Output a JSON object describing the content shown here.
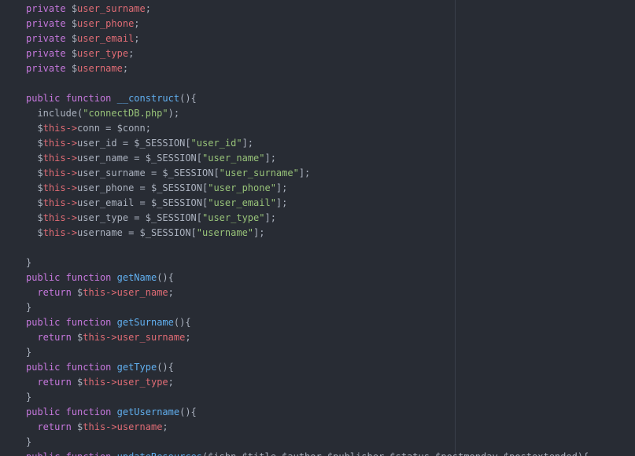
{
  "editor": {
    "colors": {
      "background": "#282c34",
      "wrap_guide": "#3a3f4a"
    },
    "token_colors": {
      "kw": "#c678dd",
      "var": "#e06c75",
      "fn": "#61afef",
      "str": "#98c379",
      "plain": "#abb2bf"
    },
    "lines": [
      [
        [
          "kw",
          "private"
        ],
        [
          "plain",
          " "
        ],
        [
          "plain",
          "$"
        ],
        [
          "var",
          "user_surname"
        ],
        [
          "plain",
          ";"
        ]
      ],
      [
        [
          "kw",
          "private"
        ],
        [
          "plain",
          " "
        ],
        [
          "plain",
          "$"
        ],
        [
          "var",
          "user_phone"
        ],
        [
          "plain",
          ";"
        ]
      ],
      [
        [
          "kw",
          "private"
        ],
        [
          "plain",
          " "
        ],
        [
          "plain",
          "$"
        ],
        [
          "var",
          "user_email"
        ],
        [
          "plain",
          ";"
        ]
      ],
      [
        [
          "kw",
          "private"
        ],
        [
          "plain",
          " "
        ],
        [
          "plain",
          "$"
        ],
        [
          "var",
          "user_type"
        ],
        [
          "plain",
          ";"
        ]
      ],
      [
        [
          "kw",
          "private"
        ],
        [
          "plain",
          " "
        ],
        [
          "plain",
          "$"
        ],
        [
          "var",
          "username"
        ],
        [
          "plain",
          ";"
        ]
      ],
      [],
      [
        [
          "kw",
          "public"
        ],
        [
          "plain",
          " "
        ],
        [
          "kw",
          "function"
        ],
        [
          "plain",
          " "
        ],
        [
          "fn",
          "__construct"
        ],
        [
          "plain",
          "(){"
        ]
      ],
      [
        [
          "plain",
          "  "
        ],
        [
          "plain",
          "include("
        ],
        [
          "str",
          "\"connectDB.php\""
        ],
        [
          "plain",
          ");"
        ]
      ],
      [
        [
          "plain",
          "  $"
        ],
        [
          "var",
          "this"
        ],
        [
          "var",
          "->"
        ],
        [
          "plain",
          "conn = $conn;"
        ]
      ],
      [
        [
          "plain",
          "  $"
        ],
        [
          "var",
          "this"
        ],
        [
          "var",
          "->"
        ],
        [
          "plain",
          "user_id = $_SESSION["
        ],
        [
          "str",
          "\"user_id\""
        ],
        [
          "plain",
          "];"
        ]
      ],
      [
        [
          "plain",
          "  $"
        ],
        [
          "var",
          "this"
        ],
        [
          "var",
          "->"
        ],
        [
          "plain",
          "user_name = $_SESSION["
        ],
        [
          "str",
          "\"user_name\""
        ],
        [
          "plain",
          "];"
        ]
      ],
      [
        [
          "plain",
          "  $"
        ],
        [
          "var",
          "this"
        ],
        [
          "var",
          "->"
        ],
        [
          "plain",
          "user_surname = $_SESSION["
        ],
        [
          "str",
          "\"user_surname\""
        ],
        [
          "plain",
          "];"
        ]
      ],
      [
        [
          "plain",
          "  $"
        ],
        [
          "var",
          "this"
        ],
        [
          "var",
          "->"
        ],
        [
          "plain",
          "user_phone = $_SESSION["
        ],
        [
          "str",
          "\"user_phone\""
        ],
        [
          "plain",
          "];"
        ]
      ],
      [
        [
          "plain",
          "  $"
        ],
        [
          "var",
          "this"
        ],
        [
          "var",
          "->"
        ],
        [
          "plain",
          "user_email = $_SESSION["
        ],
        [
          "str",
          "\"user_email\""
        ],
        [
          "plain",
          "];"
        ]
      ],
      [
        [
          "plain",
          "  $"
        ],
        [
          "var",
          "this"
        ],
        [
          "var",
          "->"
        ],
        [
          "plain",
          "user_type = $_SESSION["
        ],
        [
          "str",
          "\"user_type\""
        ],
        [
          "plain",
          "];"
        ]
      ],
      [
        [
          "plain",
          "  $"
        ],
        [
          "var",
          "this"
        ],
        [
          "var",
          "->"
        ],
        [
          "plain",
          "username = $_SESSION["
        ],
        [
          "str",
          "\"username\""
        ],
        [
          "plain",
          "];"
        ]
      ],
      [],
      [
        [
          "plain",
          "}"
        ]
      ],
      [
        [
          "kw",
          "public"
        ],
        [
          "plain",
          " "
        ],
        [
          "kw",
          "function"
        ],
        [
          "plain",
          " "
        ],
        [
          "fn",
          "getName"
        ],
        [
          "plain",
          "(){"
        ]
      ],
      [
        [
          "plain",
          "  "
        ],
        [
          "kw",
          "return"
        ],
        [
          "plain",
          " $"
        ],
        [
          "var",
          "this"
        ],
        [
          "var",
          "->"
        ],
        [
          "var",
          "user_name"
        ],
        [
          "plain",
          ";"
        ]
      ],
      [
        [
          "plain",
          "}"
        ]
      ],
      [
        [
          "kw",
          "public"
        ],
        [
          "plain",
          " "
        ],
        [
          "kw",
          "function"
        ],
        [
          "plain",
          " "
        ],
        [
          "fn",
          "getSurname"
        ],
        [
          "plain",
          "(){"
        ]
      ],
      [
        [
          "plain",
          "  "
        ],
        [
          "kw",
          "return"
        ],
        [
          "plain",
          " $"
        ],
        [
          "var",
          "this"
        ],
        [
          "var",
          "->"
        ],
        [
          "var",
          "user_surname"
        ],
        [
          "plain",
          ";"
        ]
      ],
      [
        [
          "plain",
          "}"
        ]
      ],
      [
        [
          "kw",
          "public"
        ],
        [
          "plain",
          " "
        ],
        [
          "kw",
          "function"
        ],
        [
          "plain",
          " "
        ],
        [
          "fn",
          "getType"
        ],
        [
          "plain",
          "(){"
        ]
      ],
      [
        [
          "plain",
          "  "
        ],
        [
          "kw",
          "return"
        ],
        [
          "plain",
          " $"
        ],
        [
          "var",
          "this"
        ],
        [
          "var",
          "->"
        ],
        [
          "var",
          "user_type"
        ],
        [
          "plain",
          ";"
        ]
      ],
      [
        [
          "plain",
          "}"
        ]
      ],
      [
        [
          "kw",
          "public"
        ],
        [
          "plain",
          " "
        ],
        [
          "kw",
          "function"
        ],
        [
          "plain",
          " "
        ],
        [
          "fn",
          "getUsername"
        ],
        [
          "plain",
          "(){"
        ]
      ],
      [
        [
          "plain",
          "  "
        ],
        [
          "kw",
          "return"
        ],
        [
          "plain",
          " $"
        ],
        [
          "var",
          "this"
        ],
        [
          "var",
          "->"
        ],
        [
          "var",
          "username"
        ],
        [
          "plain",
          ";"
        ]
      ],
      [
        [
          "plain",
          "}"
        ]
      ],
      [
        [
          "kw",
          "public"
        ],
        [
          "plain",
          " "
        ],
        [
          "kw",
          "function"
        ],
        [
          "plain",
          " "
        ],
        [
          "fn",
          "updateResources"
        ],
        [
          "plain",
          "($isbn,$title,$author,$publisher,$status,$postmonday,$postextended){"
        ]
      ]
    ]
  }
}
